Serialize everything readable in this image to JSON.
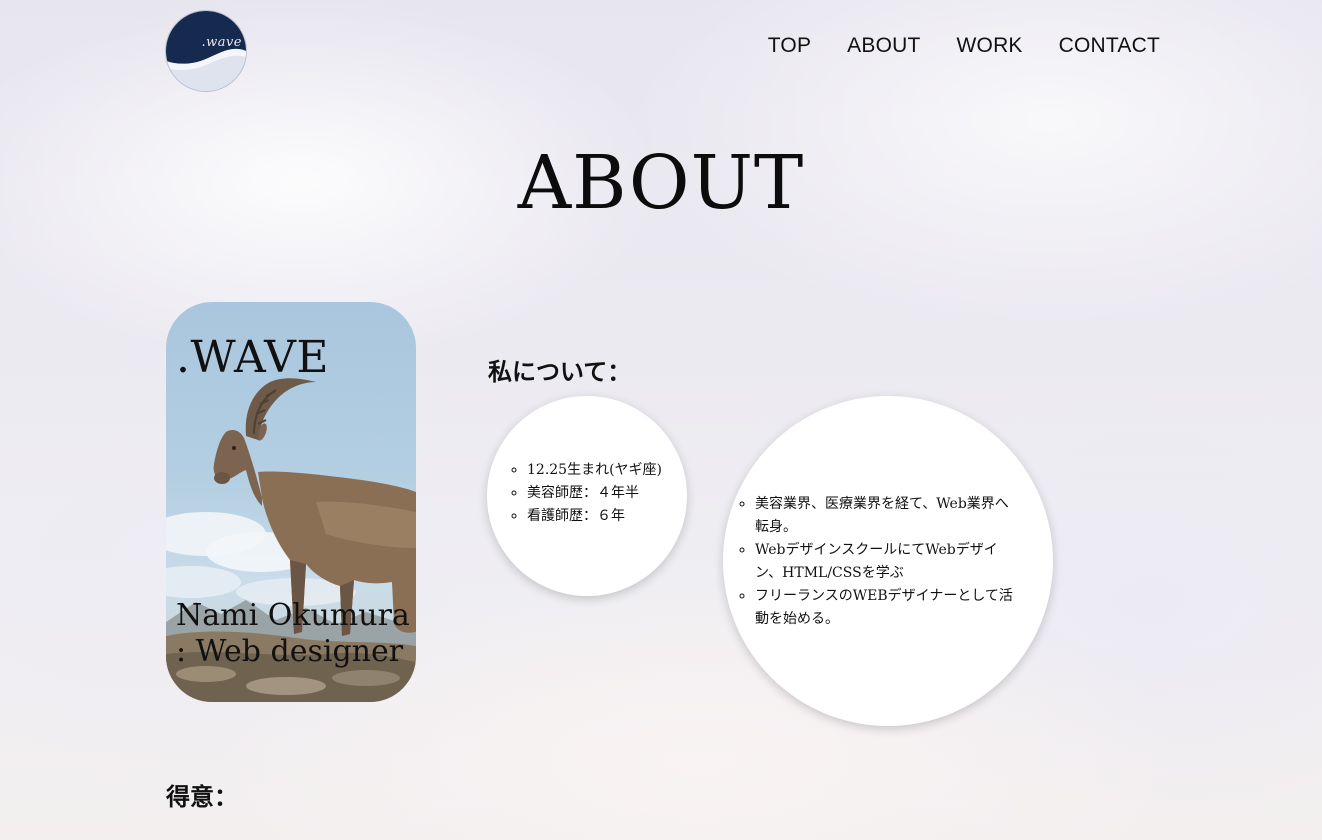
{
  "header": {
    "logo_text": ".wave",
    "nav": [
      {
        "label": "TOP"
      },
      {
        "label": "ABOUT"
      },
      {
        "label": "WORK"
      },
      {
        "label": "CONTACT"
      }
    ]
  },
  "page_title": "ABOUT",
  "profile_card": {
    "brand": ".WAVE",
    "name_line1": "Nami Okumura",
    "name_line2": ": Web designer"
  },
  "about": {
    "heading": "私について：",
    "personal_items": [
      "12.25生まれ(ヤギ座)",
      "美容師歴：４年半",
      "看護師歴：６年"
    ],
    "career_items": [
      "美容業界、医療業界を経て、Web業界へ転身。",
      "WebデザインスクールにてWebデザイン、HTML/CSSを学ぶ",
      "フリーランスのWEBデザイナーとして活動を始める。"
    ]
  },
  "skills": {
    "heading": "得意："
  },
  "colors": {
    "logo_navy": "#16294f",
    "bubble": "#ffffff",
    "text": "#111111"
  }
}
